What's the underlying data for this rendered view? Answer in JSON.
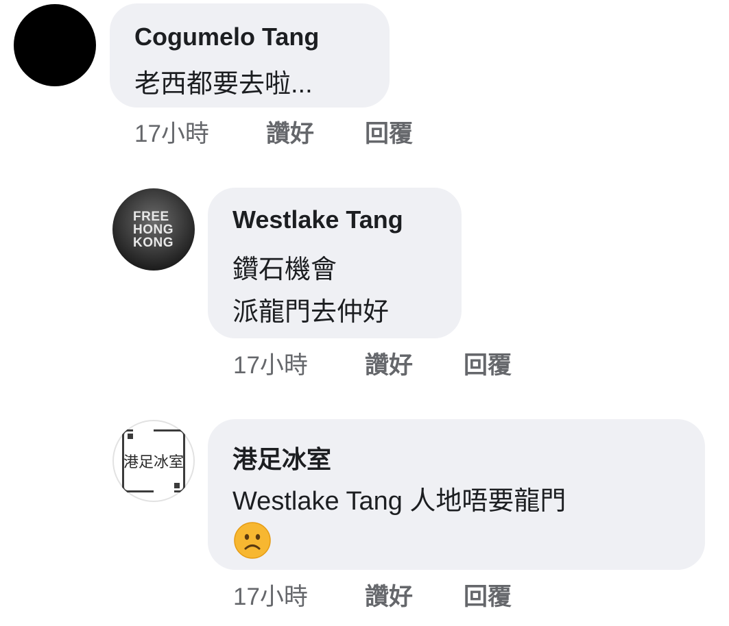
{
  "comments": [
    {
      "author": "Cogumelo Tang",
      "lines": [
        "老西都要去啦..."
      ],
      "time": "17小時",
      "like_label": "讚好",
      "reply_label": "回覆"
    },
    {
      "author": "Westlake Tang",
      "avatar_text": [
        "FREE",
        "HONG",
        "KONG"
      ],
      "lines": [
        "鑽石機會",
        "派龍門去仲好"
      ],
      "time": "17小時",
      "like_label": "讚好",
      "reply_label": "回覆"
    },
    {
      "author": "港足冰室",
      "avatar_text": "港足冰室",
      "lines": [
        "Westlake Tang 人地唔要龍門"
      ],
      "emoji": "sad-face-emoji",
      "time": "17小時",
      "like_label": "讚好",
      "reply_label": "回覆"
    }
  ],
  "colors": {
    "bubble": "#eff0f4",
    "text": "#1c1e21",
    "meta": "#65676b",
    "emoji_face": "#f7b731"
  }
}
